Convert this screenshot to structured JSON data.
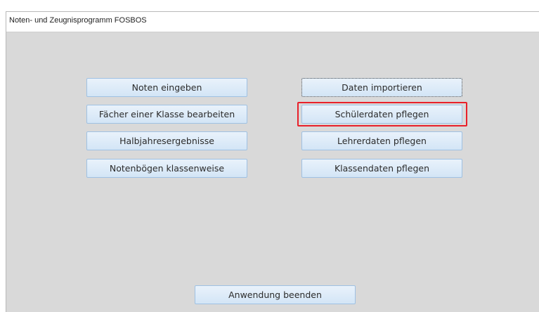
{
  "window": {
    "title": "Noten- und Zeugnisprogramm FOSBOS"
  },
  "buttons": {
    "noten_eingeben": "Noten eingeben",
    "faecher_bearbeiten": "Fächer einer Klasse bearbeiten",
    "halbjahresergebnisse": "Halbjahresergebnisse",
    "notenboegen": "Notenbögen klassenweise",
    "daten_importieren": "Daten importieren",
    "schuelerdaten": "Schülerdaten pflegen",
    "lehrerdaten": "Lehrerdaten pflegen",
    "klassendaten": "Klassendaten pflegen",
    "beenden": "Anwendung beenden"
  },
  "colors": {
    "highlight": "#e8202a",
    "button_border": "#9fc1e3",
    "background": "#d9d9d9"
  }
}
